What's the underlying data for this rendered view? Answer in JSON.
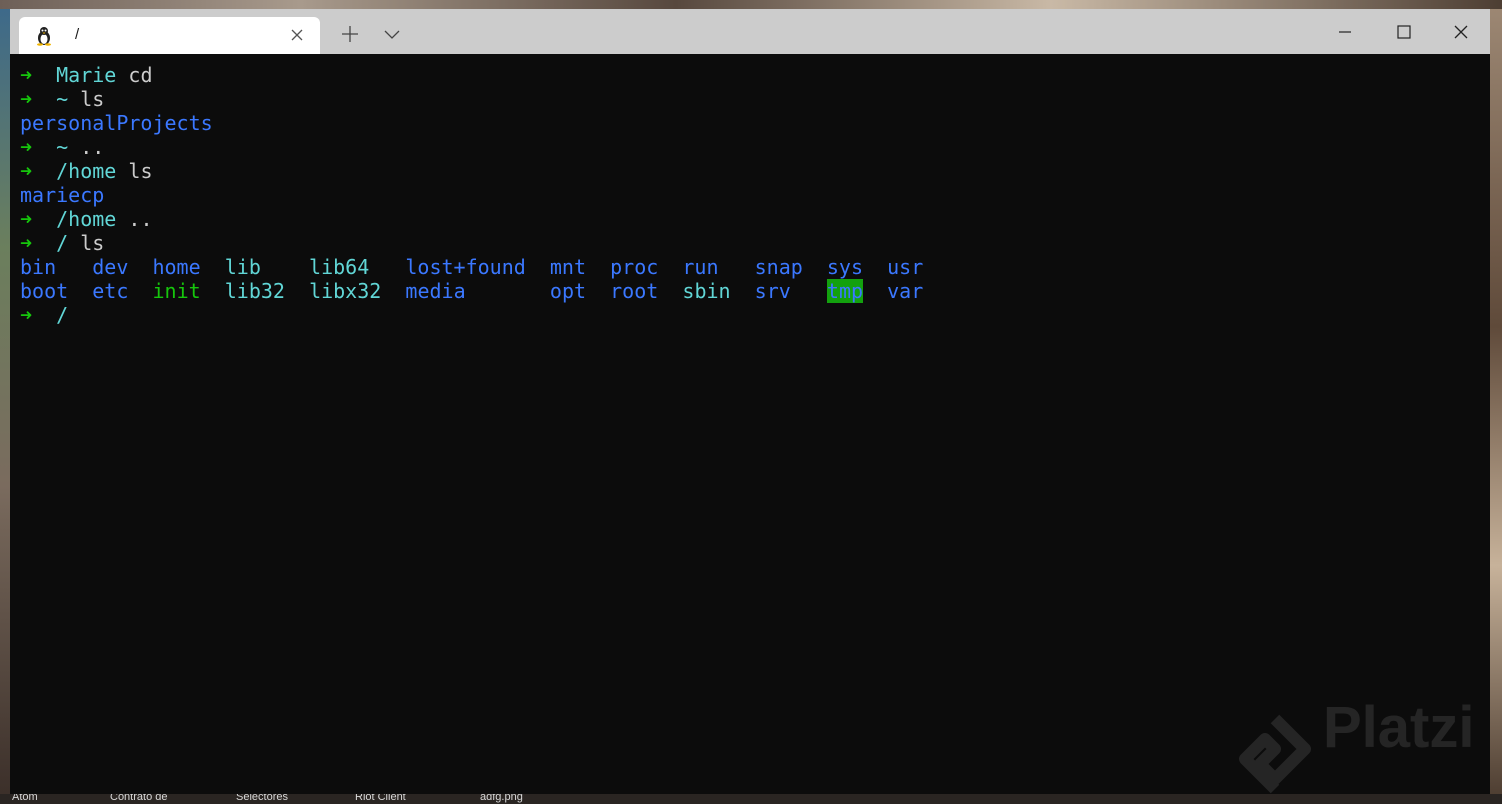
{
  "window": {
    "tab_title": "/",
    "tab_icon": "linux-penguin-icon"
  },
  "terminal": {
    "lines": [
      {
        "prompt": "➜",
        "path": "Marie",
        "cmd": " cd"
      },
      {
        "prompt": "➜",
        "path": "~",
        "cmd": " ls"
      },
      {
        "output": "personalProjects"
      },
      {
        "prompt": "➜",
        "path": "~",
        "cmd": " .."
      },
      {
        "prompt": "➜",
        "path": "/home",
        "cmd": " ls"
      },
      {
        "output": "mariecp"
      },
      {
        "prompt": "➜",
        "path": "/home",
        "cmd": " .."
      },
      {
        "prompt": "➜",
        "path": "/",
        "cmd": " ls"
      }
    ],
    "listing_row1": [
      "bin",
      "dev",
      "home",
      "lib",
      "lib64",
      "lost+found",
      "mnt",
      "proc",
      "run",
      "snap",
      "sys",
      "usr"
    ],
    "listing_row2": [
      "boot",
      "etc",
      "init",
      "lib32",
      "libx32",
      "media",
      "opt",
      "root",
      "sbin",
      "srv",
      "tmp",
      "var"
    ],
    "final_prompt": {
      "prompt": "➜",
      "path": "/"
    }
  },
  "watermark": "Platzi",
  "taskbar": [
    "Atom",
    "Contrato de",
    "Selectores",
    "Riot Client",
    "adfg.png"
  ],
  "colors": {
    "prompt_green": "#16c60c",
    "path_cyan": "#61d6d6",
    "dir_blue": "#3b78ff",
    "highlight_bg": "#13a10e",
    "terminal_bg": "#0c0c0c"
  }
}
